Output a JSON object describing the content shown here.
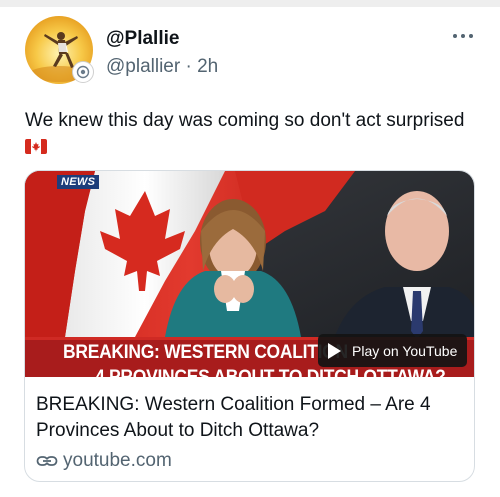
{
  "tweet": {
    "display_name": "@Plallie",
    "handle": "@plallier",
    "separator": "·",
    "time": "2h",
    "text": "We knew this day was coming so don't act surprised",
    "emoji": "canadian-flag",
    "more_icon": "more-horizontal-icon"
  },
  "card": {
    "thumbnail_tag": "NEWS",
    "thumbnail_headline_line1": "BREAKING: WESTERN COALITION",
    "thumbnail_headline_line2": "4 PROVINCES ABOUT TO DITCH OTTAWA?",
    "play_button_label": "Play on YouTube",
    "title": "BREAKING: Western Coalition Formed – Are 4 Provinces About to Ditch Ottawa?",
    "domain": "youtube.com",
    "link_icon": "link-icon"
  },
  "colors": {
    "text_primary": "#0f1419",
    "text_secondary": "#536471",
    "card_border": "#d7dde2",
    "flag_red": "#d52b1e",
    "banner_red": "#a81c1c"
  }
}
